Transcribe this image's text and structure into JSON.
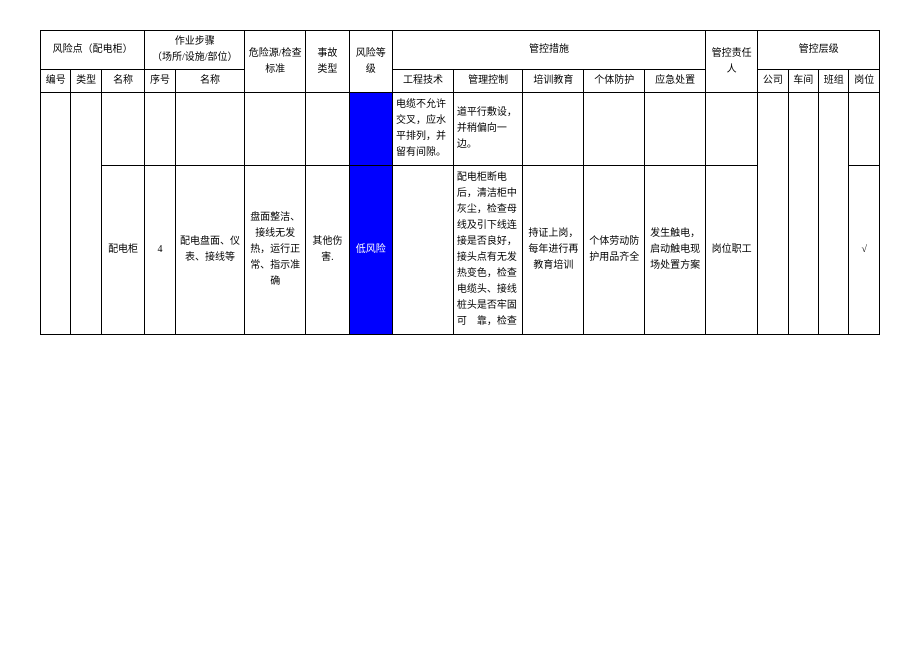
{
  "headers_top": {
    "risk_point": "风险点（配电柜）",
    "work_step": "作业步骤\n（场所/设施/部位）",
    "hazard_source": "危险源/检查\n标准",
    "accident_type": "事故\n类型",
    "risk_level": "风险等级",
    "control_measures": "管控措施",
    "responsible": "管控责任人",
    "control_level": "管控层级"
  },
  "headers_sub": {
    "number": "编号",
    "type": "类型",
    "name": "名称",
    "seq": "序号",
    "step_name": "名称",
    "eng": "工程技术",
    "mgmt": "管理控制",
    "train": "培训教育",
    "ppe": "个体防护",
    "emerg": "应急处置",
    "company": "公司",
    "workshop": "车间",
    "team": "班组",
    "post": "岗位"
  },
  "rows": [
    {
      "number": "",
      "type": "",
      "name": "",
      "seq": "",
      "step_name": "",
      "hazard": "",
      "acc_type": "",
      "risk_level": "",
      "eng": "电缆不允许交叉，应水平排列，并留有间隙。",
      "mgmt": "道平行敷设，并稍偏向一边。",
      "train": "",
      "ppe": "",
      "emerg": "",
      "resp": "",
      "company": "",
      "workshop": "",
      "team": "",
      "post": ""
    },
    {
      "number": "",
      "type": "",
      "name": "配电柜",
      "seq": "4",
      "step_name": "配电盘面、仪表、接线等",
      "hazard": "盘面整洁、接线无发热，运行正常、指示准确",
      "acc_type": "其他伤害.",
      "risk_level": "低风险",
      "eng": "",
      "mgmt": "配电柜断电后，清洁柜中灰尘，检查母线及引下线连接是否良好，接头点有无发热变色，检查电缆头、接线桩头是否牢固可　靠，检查",
      "train": "持证上岗，每年进行再教育培训",
      "ppe": "个体劳动防护用品齐全",
      "emerg": "发生触电，启动触电现场处置方案",
      "resp": "岗位职工",
      "company": "",
      "workshop": "",
      "team": "",
      "post": "√"
    }
  ]
}
